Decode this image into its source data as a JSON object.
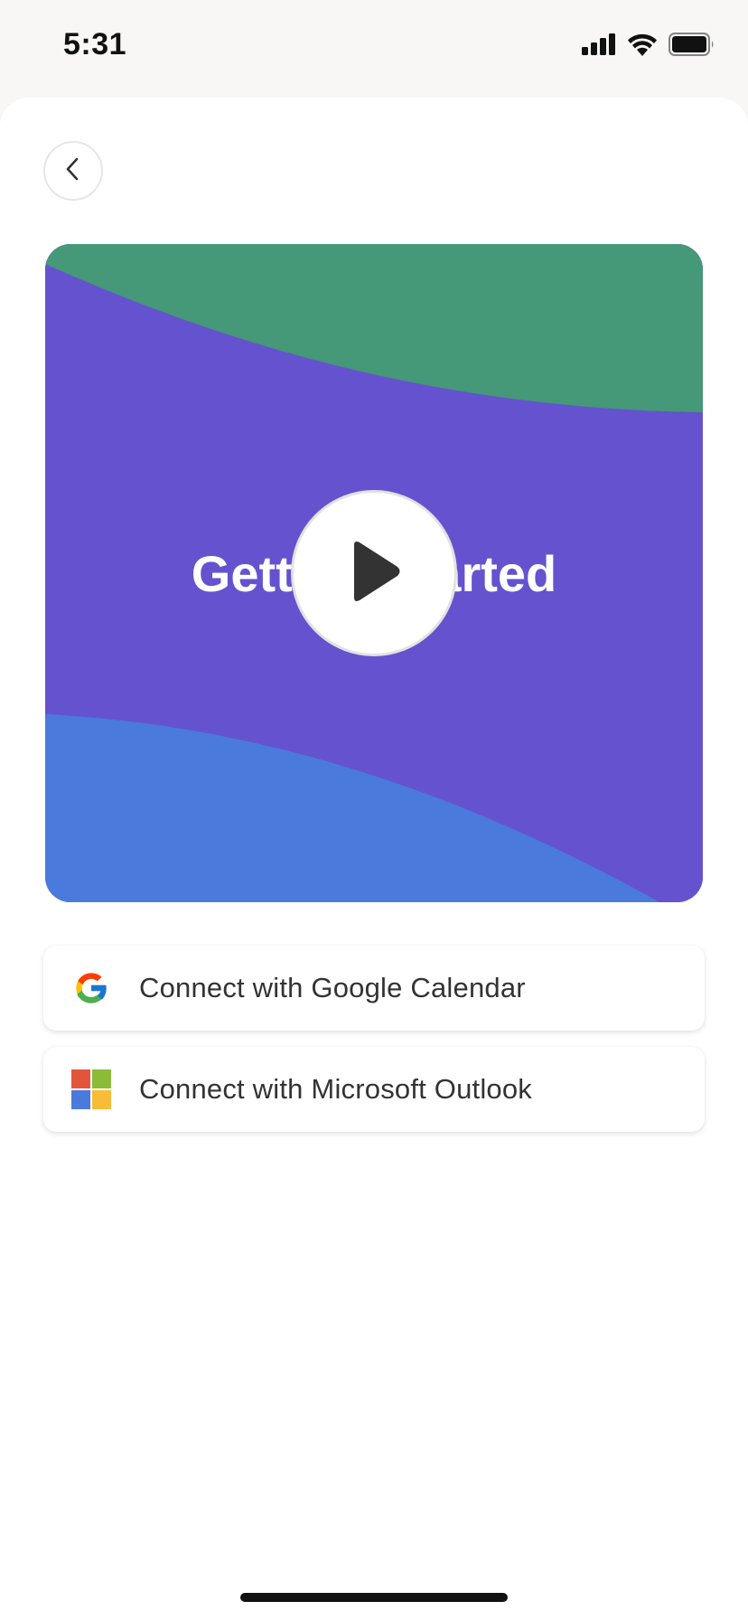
{
  "status_bar": {
    "time": "5:31",
    "icons": [
      "cellular-signal-icon",
      "wifi-icon",
      "battery-icon"
    ]
  },
  "navigation": {
    "back_icon": "chevron-left-icon"
  },
  "video": {
    "title": "Getting Started",
    "play_icon": "play-icon",
    "colors": {
      "top_band": "#459878",
      "middle": "#6552cf",
      "bottom_band": "#4a7bdc"
    }
  },
  "connect_options": [
    {
      "label": "Connect with Google Calendar",
      "icon": "google-logo-icon"
    },
    {
      "label": "Connect with Microsoft Outlook",
      "icon": "microsoft-logo-icon"
    }
  ]
}
